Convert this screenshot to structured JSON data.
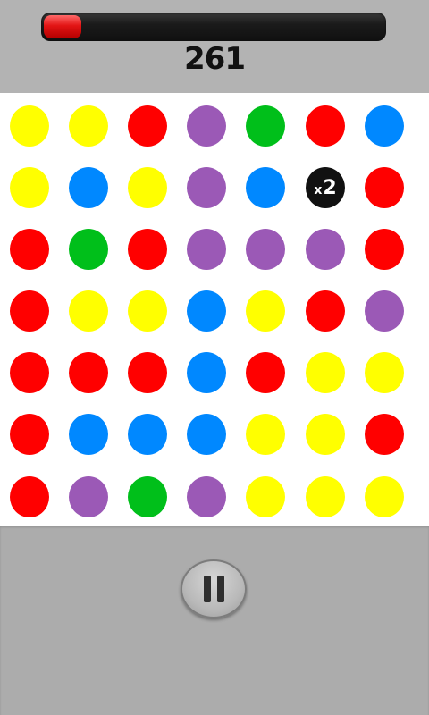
{
  "hud": {
    "score": "261",
    "timer_fraction": 0.11
  },
  "colors": {
    "yellow": "#ffff00",
    "red": "#ff0000",
    "purple": "#9b59b6",
    "green": "#00bf1a",
    "blue": "#0088ff",
    "black": "#111111"
  },
  "board": {
    "rows": [
      [
        "yellow",
        "yellow",
        "red",
        "purple",
        "green",
        "red",
        "blue"
      ],
      [
        "yellow",
        "blue",
        "yellow",
        "purple",
        "blue",
        "x2",
        "red"
      ],
      [
        "red",
        "green",
        "red",
        "purple",
        "purple",
        "purple",
        "red"
      ],
      [
        "red",
        "yellow",
        "yellow",
        "blue",
        "yellow",
        "red",
        "purple"
      ],
      [
        "red",
        "red",
        "red",
        "blue",
        "red",
        "yellow",
        "yellow"
      ],
      [
        "red",
        "blue",
        "blue",
        "blue",
        "yellow",
        "yellow",
        "red"
      ],
      [
        "red",
        "purple",
        "green",
        "purple",
        "yellow",
        "yellow",
        "yellow"
      ]
    ],
    "multiplier": {
      "prefix": "x",
      "value": "2"
    }
  },
  "controls": {
    "pause_icon": "pause-icon"
  }
}
